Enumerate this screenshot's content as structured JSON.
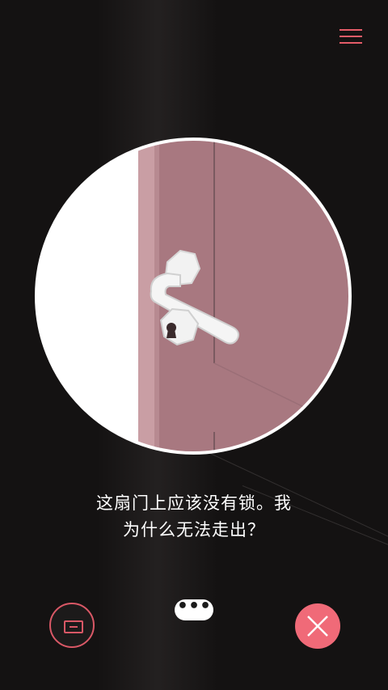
{
  "scene": {
    "description_icons": [
      "door-icon",
      "door-handle-icon",
      "keyhole-icon"
    ]
  },
  "dialog": {
    "line1": "这扇门上应该没有锁。我",
    "line2": "为什么无法走出？"
  },
  "buttons": {
    "more_label": "•••"
  },
  "colors": {
    "accent": "#e45c68",
    "close_fill": "#f06a78",
    "door": "#a87880",
    "door_edge": "#c69aa0",
    "background": "#141212"
  }
}
